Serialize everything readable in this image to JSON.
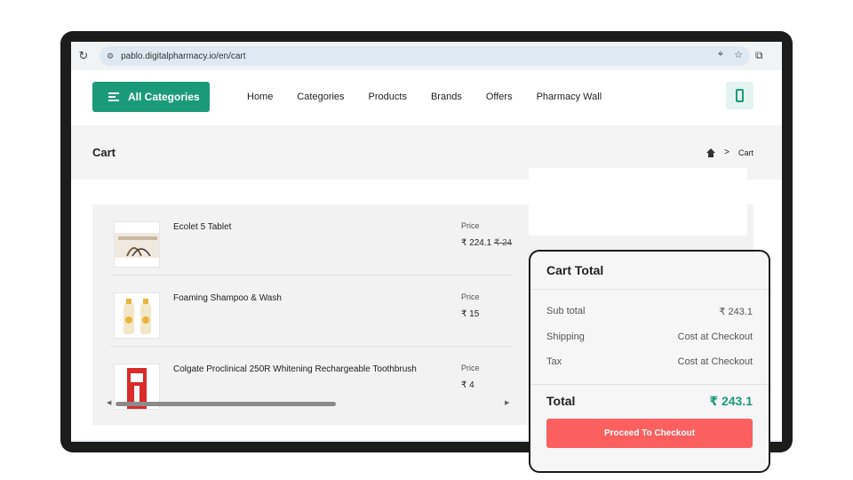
{
  "browser": {
    "url": "pablo.digitalpharmacy.io/en/cart"
  },
  "nav": {
    "all_categories": "All Categories",
    "menu": [
      "Home",
      "Categories",
      "Products",
      "Brands",
      "Offers",
      "Pharmacy Wall"
    ]
  },
  "page": {
    "title": "Cart",
    "breadcrumb_current": "Cart",
    "breadcrumb_sep": ">"
  },
  "cart": {
    "items": [
      {
        "name": "Ecolet 5 Tablet",
        "price_label": "Price",
        "price": "₹ 224.1",
        "old_price": "₹ 24"
      },
      {
        "name": "Foaming Shampoo & Wash",
        "price_label": "Price",
        "price": "₹ 15",
        "old_price": ""
      },
      {
        "name": "Colgate Proclinical 250R Whitening Rechargeable Toothbrush",
        "price_label": "Price",
        "price": "₹ 4",
        "old_price": ""
      }
    ]
  },
  "totals": {
    "title": "Cart Total",
    "subtotal_label": "Sub total",
    "subtotal_value": "₹ 243.1",
    "shipping_label": "Shipping",
    "shipping_value": "Cost at Checkout",
    "tax_label": "Tax",
    "tax_value": "Cost at Checkout",
    "total_label": "Total",
    "total_value": "₹ 243.1",
    "checkout_label": "Proceed To Checkout"
  },
  "colors": {
    "accent": "#1b9a7a",
    "checkout": "#fb5f5f"
  }
}
